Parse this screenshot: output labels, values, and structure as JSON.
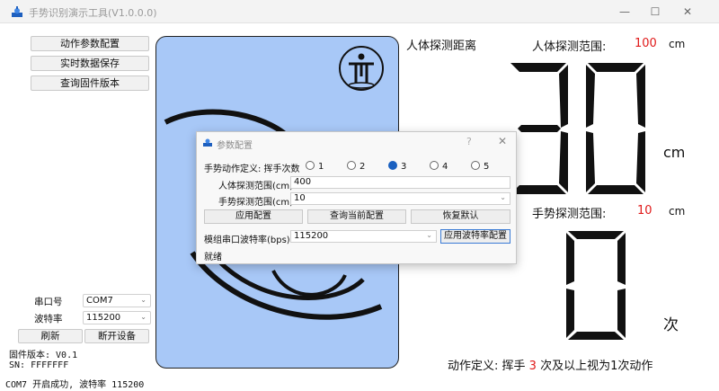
{
  "window": {
    "title": "手势识别演示工具(V1.0.0.0)",
    "minimize_glyph": "—",
    "maximize_glyph": "☐",
    "close_glyph": "✕",
    "app_icon": "radar-sensor-icon"
  },
  "left_panel": {
    "buttons": [
      "动作参数配置",
      "实时数据保存",
      "查询固件版本"
    ],
    "port_label": "串口号",
    "port_value": "COM7",
    "baud_label": "波特率",
    "baud_value": "115200",
    "refresh_label": "刷新",
    "disconnect_label": "断开设备",
    "firmware_line": "固件版本: V0.1",
    "sn_line": "SN: FFFFFFF",
    "status_line": "COM7 开启成功, 波特率 115200"
  },
  "right_panel": {
    "distance_title": "人体探测距离",
    "human_range_label": "人体探测范围:",
    "human_range_value": "100",
    "human_range_unit": "cm",
    "distance_reading": "30",
    "distance_unit": "cm",
    "gesture_range_label": "手势探测范围:",
    "gesture_range_value": "10",
    "gesture_range_unit": "cm",
    "count_reading": "0",
    "count_unit": "次",
    "action_prefix": "动作定义: 挥手",
    "action_count": "3",
    "action_suffix": "次及以上视为1次动作"
  },
  "dialog": {
    "title": "参数配置",
    "help_glyph": "?",
    "close_glyph": "✕",
    "gesture_def_label": "手势动作定义: 挥手次数",
    "radio_options": [
      "1",
      "2",
      "3",
      "4",
      "5"
    ],
    "radio_selected": "3",
    "human_range_label": "人体探测范围(cm)",
    "human_range_value": "400",
    "gesture_range_label": "手势探测范围(cm)",
    "gesture_range_value": "10",
    "apply_config": "应用配置",
    "query_config": "查询当前配置",
    "restore_default": "恢复默认",
    "baud_label": "模组串口波特率(bps)",
    "baud_value": "115200",
    "apply_baud": "应用波特率配置",
    "status": "就绪"
  },
  "colors": {
    "accent_red": "#e01a1a",
    "panel_blue": "#a8c8f7",
    "selected_radio": "#1a60c0"
  }
}
